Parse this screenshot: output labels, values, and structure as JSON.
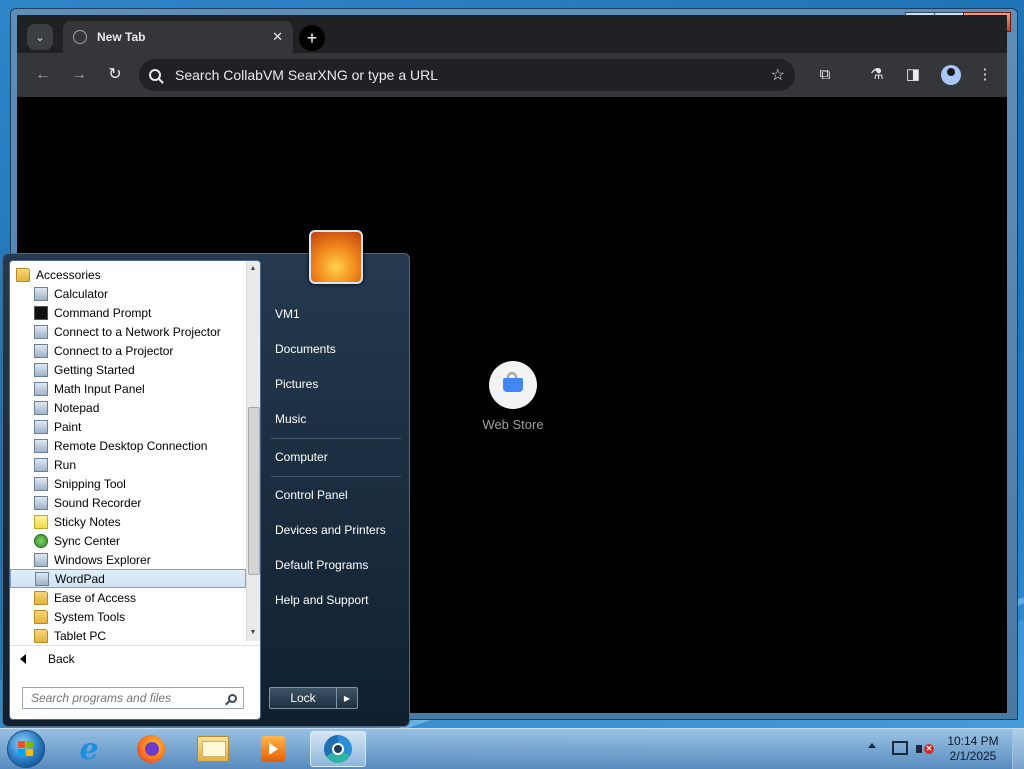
{
  "browser": {
    "tab_title": "New Tab",
    "omnibox_placeholder": "Search CollabVM SearXNG or type a URL",
    "shortcut_label": "Web Store"
  },
  "start_menu": {
    "programs": [
      {
        "label": "Accessories",
        "icon": "folder-icon",
        "kind": "category"
      },
      {
        "label": "Calculator",
        "icon": "calculator-icon",
        "kind": "app"
      },
      {
        "label": "Command Prompt",
        "icon": "command-prompt-icon",
        "kind": "app"
      },
      {
        "label": "Connect to a Network Projector",
        "icon": "network-projector-icon",
        "kind": "app"
      },
      {
        "label": "Connect to a Projector",
        "icon": "projector-icon",
        "kind": "app"
      },
      {
        "label": "Getting Started",
        "icon": "getting-started-icon",
        "kind": "app"
      },
      {
        "label": "Math Input Panel",
        "icon": "math-input-icon",
        "kind": "app"
      },
      {
        "label": "Notepad",
        "icon": "notepad-icon",
        "kind": "app"
      },
      {
        "label": "Paint",
        "icon": "paint-icon",
        "kind": "app"
      },
      {
        "label": "Remote Desktop Connection",
        "icon": "remote-desktop-icon",
        "kind": "app"
      },
      {
        "label": "Run",
        "icon": "run-icon",
        "kind": "app"
      },
      {
        "label": "Snipping Tool",
        "icon": "snipping-tool-icon",
        "kind": "app"
      },
      {
        "label": "Sound Recorder",
        "icon": "microphone-icon",
        "kind": "app"
      },
      {
        "label": "Sticky Notes",
        "icon": "sticky-notes-icon",
        "kind": "app"
      },
      {
        "label": "Sync Center",
        "icon": "sync-center-icon",
        "kind": "app"
      },
      {
        "label": "Windows Explorer",
        "icon": "windows-explorer-icon",
        "kind": "app"
      },
      {
        "label": "WordPad",
        "icon": "wordpad-icon",
        "kind": "app",
        "selected": true
      },
      {
        "label": "Ease of Access",
        "icon": "folder-icon",
        "kind": "folder"
      },
      {
        "label": "System Tools",
        "icon": "folder-icon",
        "kind": "folder"
      },
      {
        "label": "Tablet PC",
        "icon": "folder-icon",
        "kind": "folder"
      }
    ],
    "back_label": "Back",
    "search_placeholder": "Search programs and files",
    "right_links": {
      "user": "VM1",
      "documents": "Documents",
      "pictures": "Pictures",
      "music": "Music",
      "computer": "Computer",
      "control_panel": "Control Panel",
      "devices": "Devices and Printers",
      "default_programs": "Default Programs",
      "help": "Help and Support"
    },
    "lock_label": "Lock"
  },
  "taskbar": {
    "time": "10:14 PM",
    "date": "2/1/2025"
  },
  "colors": {
    "chrome_dark": "#202124",
    "chrome_toolbar": "#35363a",
    "start_menu_dark": "#10202f",
    "selection_border": "#7da2ce",
    "desktop_blue": "#1c6fb3"
  }
}
